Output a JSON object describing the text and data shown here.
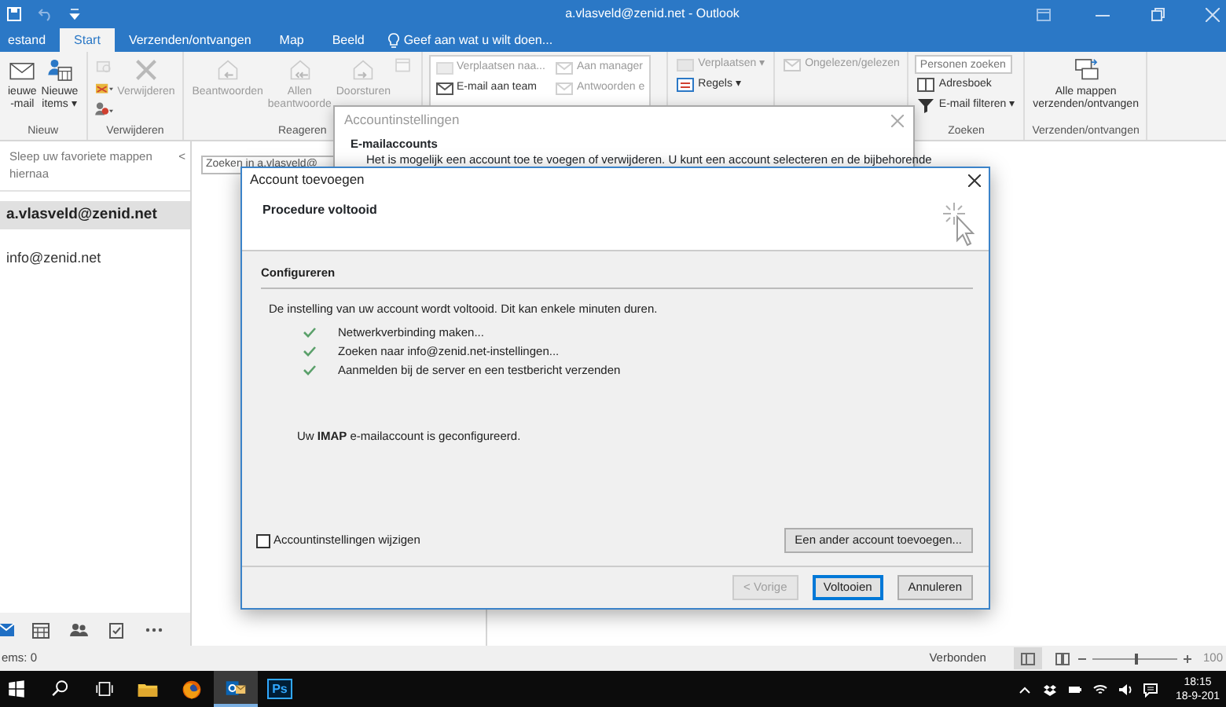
{
  "title_bar": {
    "title": "a.vlasveld@zenid.net - Outlook"
  },
  "tabs": [
    {
      "label": "estand",
      "selected": false
    },
    {
      "label": "Start",
      "selected": true
    },
    {
      "label": "Verzenden/ontvangen",
      "selected": false
    },
    {
      "label": "Map",
      "selected": false
    },
    {
      "label": "Beeld",
      "selected": false
    }
  ],
  "tell_me": "Geef aan wat u wilt doen...",
  "ribbon_groups": [
    {
      "label": "Nieuw",
      "columns": [
        [
          {
            "kind": "large",
            "lines": [
              "ieuwe",
              "-mail"
            ],
            "disabled": false
          }
        ],
        [
          {
            "kind": "large",
            "lines": [
              "Nieuwe",
              "items ▾"
            ],
            "disabled": false
          }
        ]
      ]
    },
    {
      "label": "Verwijderen",
      "columns": [
        [
          {
            "kind": "glyph",
            "disabled": true
          },
          {
            "kind": "glyph",
            "disabled": false
          },
          {
            "kind": "glyph",
            "disabled": false
          }
        ],
        [
          {
            "kind": "large",
            "lines": [
              "Verwijderen"
            ],
            "disabled": true
          }
        ]
      ]
    },
    {
      "label": "Reageren",
      "columns": [
        [
          {
            "kind": "large",
            "lines": [
              "Beantwoorden"
            ],
            "disabled": true
          }
        ],
        [
          {
            "kind": "large",
            "lines": [
              "Allen",
              "beantwoorde"
            ],
            "disabled": true
          }
        ],
        [
          {
            "kind": "large",
            "lines": [
              "Doorsturen"
            ],
            "disabled": true
          }
        ],
        [
          {
            "kind": "glyph",
            "disabled": true
          }
        ]
      ]
    },
    {
      "kind": "gallery",
      "columns": [
        [
          {
            "kind": "small",
            "lines": [
              "Verplaatsen naa..."
            ],
            "disabled": true
          },
          {
            "kind": "small",
            "lines": [
              "E-mail aan team"
            ],
            "disabled": false
          }
        ],
        [
          {
            "kind": "small",
            "lines": [
              "Aan manager"
            ],
            "disabled": true
          },
          {
            "kind": "small",
            "lines": [
              "Antwoorden e"
            ],
            "disabled": true
          }
        ]
      ]
    },
    {
      "columns": [
        [
          {
            "kind": "small",
            "lines": [
              "Verplaatsen ▾"
            ],
            "disabled": true
          },
          {
            "kind": "small",
            "lines": [
              "Regels ▾"
            ],
            "disabled": false
          }
        ]
      ]
    },
    {
      "columns": [
        [
          {
            "kind": "small",
            "lines": [
              "Ongelezen/gelezen"
            ],
            "disabled": true
          }
        ]
      ]
    },
    {
      "label": "Zoeken",
      "columns": [
        [
          {
            "kind": "field",
            "placeholder": "Personen zoeken"
          },
          {
            "kind": "small",
            "lines": [
              "Adresboek"
            ],
            "disabled": false
          },
          {
            "kind": "small",
            "lines": [
              "E-mail filteren ▾"
            ],
            "disabled": false
          }
        ]
      ]
    },
    {
      "label": "Verzenden/ontvangen",
      "columns": [
        [
          {
            "kind": "large",
            "lines": [
              "Alle mappen",
              "verzenden/ontvangen"
            ],
            "disabled": false
          }
        ]
      ]
    }
  ],
  "folder_pane": {
    "hint": "Sleep uw favoriete mappen hiernaa",
    "collapse": "<",
    "account": {
      "label": "a.vlasveld@zenid.net",
      "selected": true
    },
    "folders": [
      {
        "label": "info@zenid.net",
        "selected": false
      }
    ]
  },
  "modules": [
    {
      "selected": true
    },
    {
      "selected": false
    },
    {
      "selected": false
    },
    {
      "selected": false
    },
    {
      "selected": false
    }
  ],
  "message_list": {
    "search": {
      "placeholder": "Zoeken in a.vlasveld@"
    }
  },
  "account_settings_dialog": {
    "title": "Accountinstellingen",
    "heading": "E-mailaccounts",
    "text": "Het is mogelijk een account toe te voegen of verwijderen. U kunt een account selecteren en de bijbehorende"
  },
  "add_account_dialog": {
    "title": "Account toevoegen",
    "heading": "Procedure voltooid",
    "section": "Configureren",
    "intro": "De instelling van uw account wordt voltooid. Dit kan enkele minuten duren.",
    "steps": [
      {
        "label": "Netwerkverbinding maken...",
        "done": true
      },
      {
        "label": "Zoeken naar info@zenid.net-instellingen...",
        "done": true
      },
      {
        "label": "Aanmelden bij de server en een testbericht verzenden",
        "done": true
      }
    ],
    "result": "Uw **IMAP** e-mailaccount is geconfigureerd.",
    "checkbox": {
      "label": "Accountinstellingen wijzigen",
      "checked": false
    },
    "add_button": "Een ander account toevoegen...",
    "buttons": [
      {
        "label": "< Vorige",
        "disabled": true,
        "default": false
      },
      {
        "label": "Voltooien",
        "disabled": false,
        "default": true
      },
      {
        "label": "Annuleren",
        "disabled": false,
        "default": false
      }
    ]
  },
  "status_bar": {
    "items": "ems: 0",
    "connection": "Verbonden",
    "views": [
      {
        "selected": true
      },
      {
        "selected": false
      }
    ],
    "zoom": {
      "level": 0.5,
      "reading": "100"
    }
  },
  "taskbar": {
    "apps": [
      {
        "kind": "start"
      },
      {
        "kind": "search"
      },
      {
        "kind": "taskview"
      },
      {
        "kind": "explorer",
        "selected": false
      },
      {
        "kind": "browser",
        "selected": false
      },
      {
        "kind": "mail",
        "selected": true
      },
      {
        "kind": "photo",
        "label": "Ps",
        "selected": false
      }
    ],
    "clock": {
      "time": "18:15",
      "date": "18-9-201"
    }
  }
}
